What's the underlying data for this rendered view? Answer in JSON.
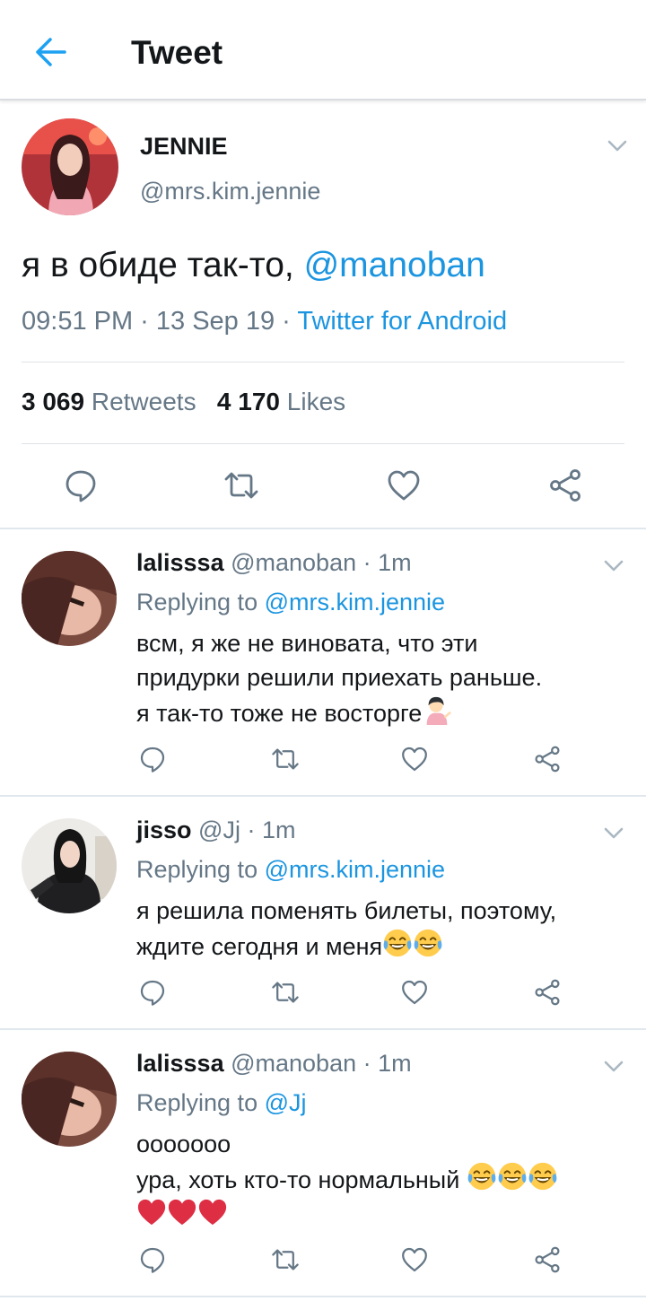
{
  "header": {
    "title": "Tweet",
    "back_icon": "arrow-left-icon",
    "accent": "#1da1f2"
  },
  "tweet": {
    "name": "JENNIE",
    "handle": "@mrs.kim.jennie",
    "text": "я в обиде так-то, ",
    "mention": "@manoban",
    "time": "09:51 PM · 13 Sep 19 · ",
    "source": "Twitter for Android",
    "retweets_count": "3 069",
    "retweets_label": "Retweets",
    "likes_count": "4 170",
    "likes_label": "Likes"
  },
  "replies": [
    {
      "name": "lalisssa",
      "meta": "@manoban · 1m",
      "replying_label": "Replying to ",
      "replying_to": "@mrs.kim.jennie",
      "lines": [
        "всм, я же не виновата, что эти",
        "придурки решили приехать раньше.",
        "я так-то тоже не восторге"
      ],
      "emoji": [
        "person-tipping-hand-emoji"
      ]
    },
    {
      "name": "jisso",
      "meta": "@Jj · 1m",
      "replying_label": "Replying to ",
      "replying_to": "@mrs.kim.jennie",
      "lines": [
        "я решила поменять билеты, поэтому,",
        "ждите сегодня и меня"
      ],
      "emoji": [
        "tears-of-joy-emoji",
        "tears-of-joy-emoji"
      ]
    },
    {
      "name": "lalisssa",
      "meta": "@manoban · 1m",
      "replying_label": "Replying to ",
      "replying_to": "@Jj",
      "lines": [
        "ооооооо",
        "ура, хоть кто-то нормальный "
      ],
      "emoji": [
        "tears-of-joy-emoji",
        "tears-of-joy-emoji",
        "tears-of-joy-emoji",
        "red-heart-emoji",
        "red-heart-emoji",
        "red-heart-emoji"
      ]
    }
  ],
  "icons": {
    "reply": "comment-icon",
    "retweet": "retweet-icon",
    "like": "heart-icon",
    "share": "share-icon",
    "menu": "chevron-down-icon"
  },
  "colors": {
    "link": "#1b95e0",
    "secondary": "#657786",
    "text": "#14171a"
  }
}
